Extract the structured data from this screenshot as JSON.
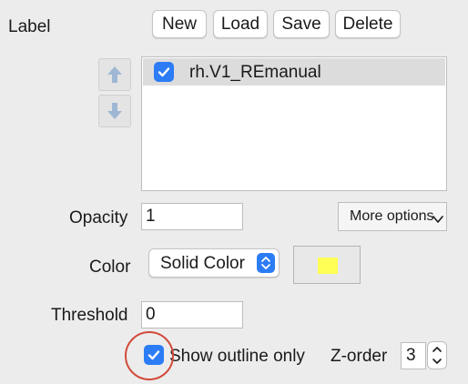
{
  "label_section": {
    "title": "Label"
  },
  "toolbar": {
    "new_label": "New",
    "load_label": "Load",
    "save_label": "Save",
    "delete_label": "Delete"
  },
  "labels_list": {
    "items": [
      {
        "name": "rh.V1_REmanual",
        "checked": true
      }
    ]
  },
  "opacity": {
    "label": "Opacity",
    "value": "1"
  },
  "more_options": {
    "label": "More options"
  },
  "color": {
    "label": "Color",
    "mode": "Solid Color",
    "swatch_color": "#ffff55"
  },
  "threshold": {
    "label": "Threshold",
    "value": "0"
  },
  "outline": {
    "label": "Show outline only",
    "checked": true
  },
  "z_order": {
    "label": "Z-order",
    "value": "3"
  },
  "colors": {
    "accent": "#2c7cf6",
    "annotation": "#d24a3a",
    "arrow": "#9fb7d4"
  }
}
